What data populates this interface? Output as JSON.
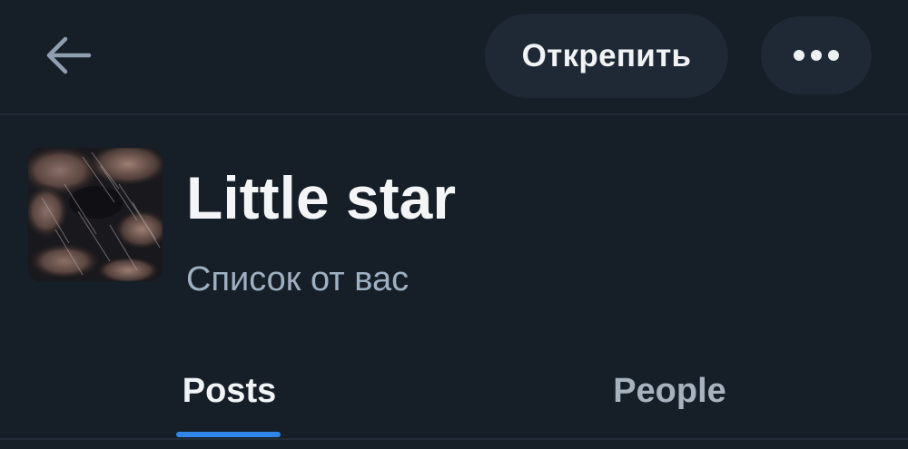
{
  "header": {
    "back_icon": "arrow-left-icon",
    "unpin_label": "Открепить",
    "more_icon": "ellipsis-icon"
  },
  "list": {
    "title": "Little star",
    "subtitle": "Список от вас",
    "avatar_icon": "list-avatar-image"
  },
  "tabs": [
    {
      "label": "Posts",
      "selected": true
    },
    {
      "label": "People",
      "selected": false
    }
  ],
  "colors": {
    "background": "#161e27",
    "button_bg": "#1e2935",
    "accent": "#2f86e8",
    "subtitle": "#9fb0c2"
  }
}
